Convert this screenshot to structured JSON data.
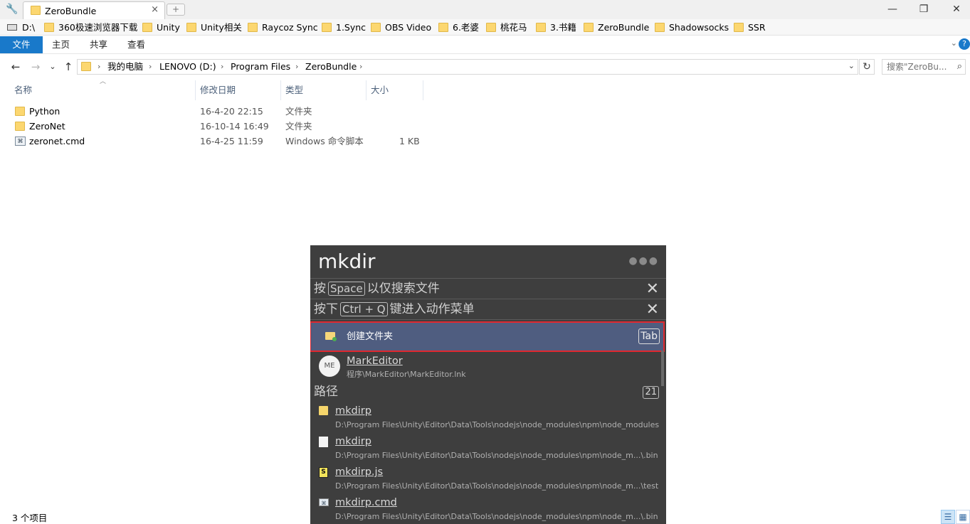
{
  "window": {
    "tab_title": "ZeroBundle",
    "tab_close": "×",
    "new_tab": "+",
    "controls": {
      "minimize": "—",
      "restore": "❐",
      "close": "✕"
    }
  },
  "bookmarks": {
    "drive": "D:\\",
    "items": [
      "360极速浏览器下载",
      "Unity",
      "Unity相关",
      "Raycoz Sync",
      "1.Sync",
      "OBS Video",
      "6.老婆",
      "桃花马",
      "3.书籍",
      "ZeroBundle",
      "Shadowsocks",
      "SSR"
    ]
  },
  "ribbon": {
    "file": "文件",
    "tabs": [
      "主页",
      "共享",
      "查看"
    ],
    "expand": "⌄",
    "help": "?"
  },
  "nav": {
    "back": "←",
    "forward": "→",
    "recent": "⌄",
    "up": "↑"
  },
  "address": {
    "crumbs": [
      "我的电脑",
      "LENOVO (D:)",
      "Program Files",
      "ZeroBundle"
    ],
    "separator": "›",
    "dropdown": "⌄",
    "refresh": "↻"
  },
  "search": {
    "placeholder": "搜索\"ZeroBu...",
    "icon": "search-icon"
  },
  "file_list": {
    "columns": {
      "name": "名称",
      "modified": "修改日期",
      "type": "类型",
      "size": "大小"
    },
    "sort_arrow": "︿",
    "rows": [
      {
        "name": "Python",
        "modified": "16-4-20 22:15",
        "type": "文件夹",
        "size": "",
        "icon": "folder-icon"
      },
      {
        "name": "ZeroNet",
        "modified": "16-10-14 16:49",
        "type": "文件夹",
        "size": "",
        "icon": "folder-icon"
      },
      {
        "name": "zeronet.cmd",
        "modified": "16-4-25 11:59",
        "type": "Windows 命令脚本",
        "size": "1 KB",
        "icon": "cmd-file-icon"
      }
    ]
  },
  "status": {
    "count": "3 个项目"
  },
  "launcher": {
    "query": "mkdir",
    "menu_dots": "●●●",
    "hint1": {
      "pre": "按",
      "key": "Space",
      "post": "以仅搜索文件"
    },
    "hint2": {
      "pre": "按下",
      "key": "Ctrl + Q",
      "post": "键进入动作菜单"
    },
    "close": "✕",
    "selected": {
      "label": "创建文件夹",
      "key": "Tab"
    },
    "app": {
      "avatar": "ME",
      "title": "MarkEditor",
      "path": "程序\\MarkEditor\\MarkEditor.lnk"
    },
    "section": {
      "label": "路径",
      "count": "21"
    },
    "results": [
      {
        "title": "mkdirp",
        "path": "D:\\Program Files\\Unity\\Editor\\Data\\Tools\\nodejs\\node_modules\\npm\\node_modules",
        "icon": "folder-icon"
      },
      {
        "title": "mkdirp",
        "path": "D:\\Program Files\\Unity\\Editor\\Data\\Tools\\nodejs\\node_modules\\npm\\node_m...\\.bin",
        "icon": "file-icon"
      },
      {
        "title": "mkdirp.js",
        "path": "D:\\Program Files\\Unity\\Editor\\Data\\Tools\\nodejs\\node_modules\\npm\\node_m...\\test",
        "icon": "js-file-icon"
      },
      {
        "title": "mkdirp.cmd",
        "path": "D:\\Program Files\\Unity\\Editor\\Data\\Tools\\nodejs\\node_modules\\npm\\node_m...\\.bin",
        "icon": "cmd-file-icon"
      }
    ]
  }
}
